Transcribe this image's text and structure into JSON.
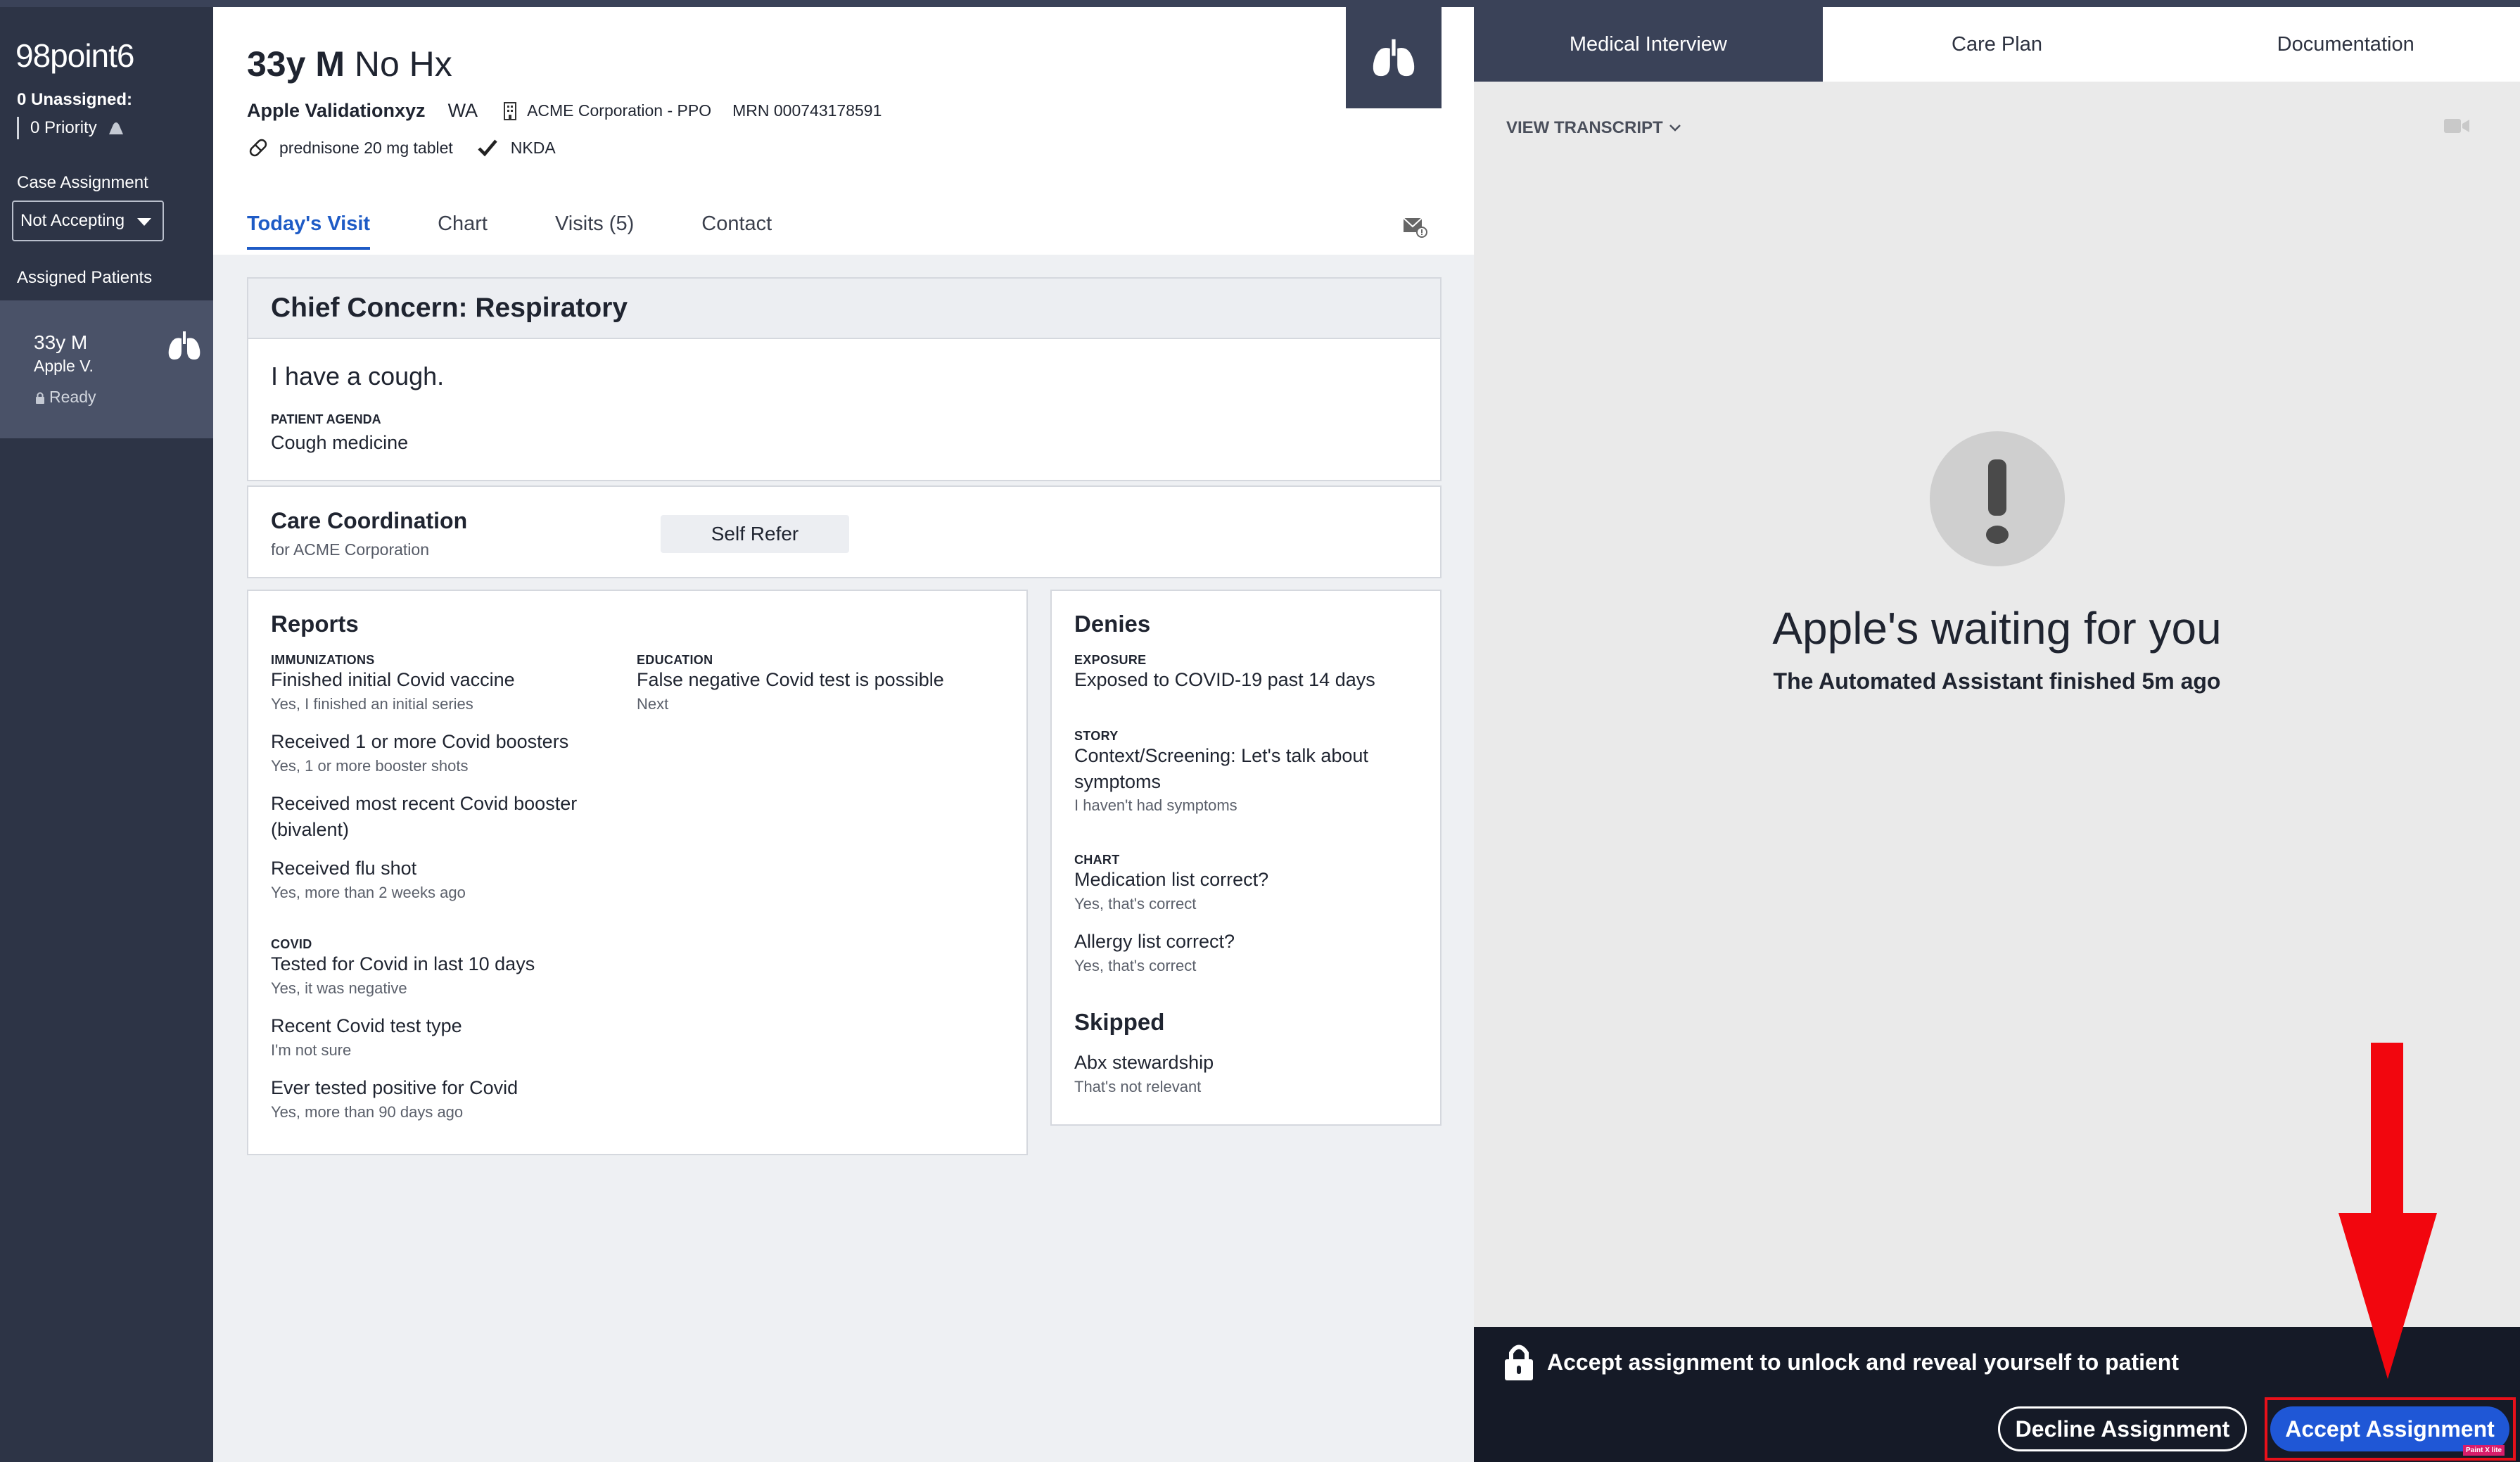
{
  "sidebar": {
    "logo": "98point6",
    "unassigned": "0 Unassigned:",
    "priority": "0 Priority",
    "case_assignment_label": "Case Assignment",
    "case_status": "Not Accepting",
    "assigned_patients_label": "Assigned Patients",
    "patient": {
      "age_sex": "33y M",
      "name": "Apple V.",
      "status": "Ready"
    }
  },
  "patient": {
    "age_sex": "33y M",
    "hx": "No Hx",
    "name": "Apple Validationxyz",
    "state": "WA",
    "insurance": "ACME Corporation - PPO",
    "mrn": "MRN 000743178591",
    "medication": "prednisone 20 mg tablet",
    "allergy": "NKDA"
  },
  "tabs": [
    "Today's Visit",
    "Chart",
    "Visits (5)",
    "Contact"
  ],
  "chief_concern": {
    "title": "Chief Concern:  Respiratory",
    "text": "I have a cough.",
    "agenda_label": "PATIENT AGENDA",
    "agenda": "Cough medicine"
  },
  "care_coordination": {
    "title": "Care Coordination",
    "subtitle": "for ACME Corporation",
    "button": "Self Refer"
  },
  "reports": {
    "title": "Reports",
    "immunizations_label": "IMMUNIZATIONS",
    "items": [
      {
        "q": "Finished initial Covid vaccine",
        "a": "Yes, I finished an initial series"
      },
      {
        "q": "Received 1 or more Covid boosters",
        "a": "Yes, 1 or more booster shots"
      },
      {
        "q": "Received most recent Covid booster (bivalent)",
        "a": ""
      },
      {
        "q": "Received flu shot",
        "a": "Yes, more than 2 weeks ago"
      }
    ],
    "covid_label": "COVID",
    "covid_items": [
      {
        "q": "Tested for Covid in last 10 days",
        "a": "Yes, it was negative"
      },
      {
        "q": "Recent Covid test type",
        "a": "I'm not sure"
      },
      {
        "q": "Ever tested positive for Covid",
        "a": "Yes, more than 90 days ago"
      }
    ],
    "education_label": "EDUCATION",
    "education": {
      "q": "False negative Covid test is possible",
      "a": "Next"
    }
  },
  "denies": {
    "title": "Denies",
    "exposure_label": "EXPOSURE",
    "exposure": {
      "q": "Exposed to COVID-19 past 14 days"
    },
    "story_label": "STORY",
    "story": {
      "q": "Context/Screening: Let's talk about symptoms",
      "a": "I haven't had symptoms"
    },
    "chart_label": "CHART",
    "chart_items": [
      {
        "q": "Medication list correct?",
        "a": "Yes, that's correct"
      },
      {
        "q": "Allergy list correct?",
        "a": "Yes, that's correct"
      }
    ],
    "skipped_title": "Skipped",
    "skipped": {
      "q": "Abx stewardship",
      "a": "That's not relevant"
    }
  },
  "right_panel": {
    "tabs": [
      "Medical Interview",
      "Care Plan",
      "Documentation"
    ],
    "view_transcript": "VIEW TRANSCRIPT",
    "waiting_title": "Apple's waiting for you",
    "waiting_subtitle": "The Automated Assistant finished 5m ago",
    "footer_message": "Accept assignment to unlock and reveal yourself to patient",
    "decline_button": "Decline Assignment",
    "accept_button": "Accept Assignment",
    "badge": "Paint X lite"
  },
  "colors": {
    "sidebar_bg": "#2d3446",
    "accent_blue": "#1f57d6",
    "tab_active": "#1e5bc6",
    "annotation_red": "#e8101a",
    "footer_bg": "#151a27"
  }
}
